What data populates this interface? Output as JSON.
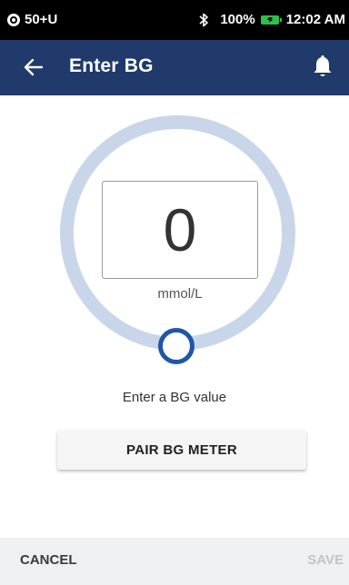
{
  "status_bar": {
    "pod_label": "50+U",
    "battery_percent": "100%",
    "time": "12:02 AM",
    "battery_color": "#2fbf4a",
    "icons": [
      "pod-status-icon",
      "bluetooth-icon",
      "battery-charging-icon"
    ]
  },
  "header": {
    "title": "Enter BG",
    "back_icon": "arrow-left-icon",
    "notification_icon": "bell-icon",
    "background_color": "#1f3a6b"
  },
  "bg_entry": {
    "value": "0",
    "unit": "mmol/L",
    "dial_level": 0,
    "dial_ring_color": "#c9d6ea",
    "handle_color": "#1f56a8"
  },
  "hint": "Enter a BG value",
  "pair_button": {
    "label": "PAIR BG METER"
  },
  "footer": {
    "cancel_label": "CANCEL",
    "save_label": "SAVE",
    "save_enabled": false
  }
}
